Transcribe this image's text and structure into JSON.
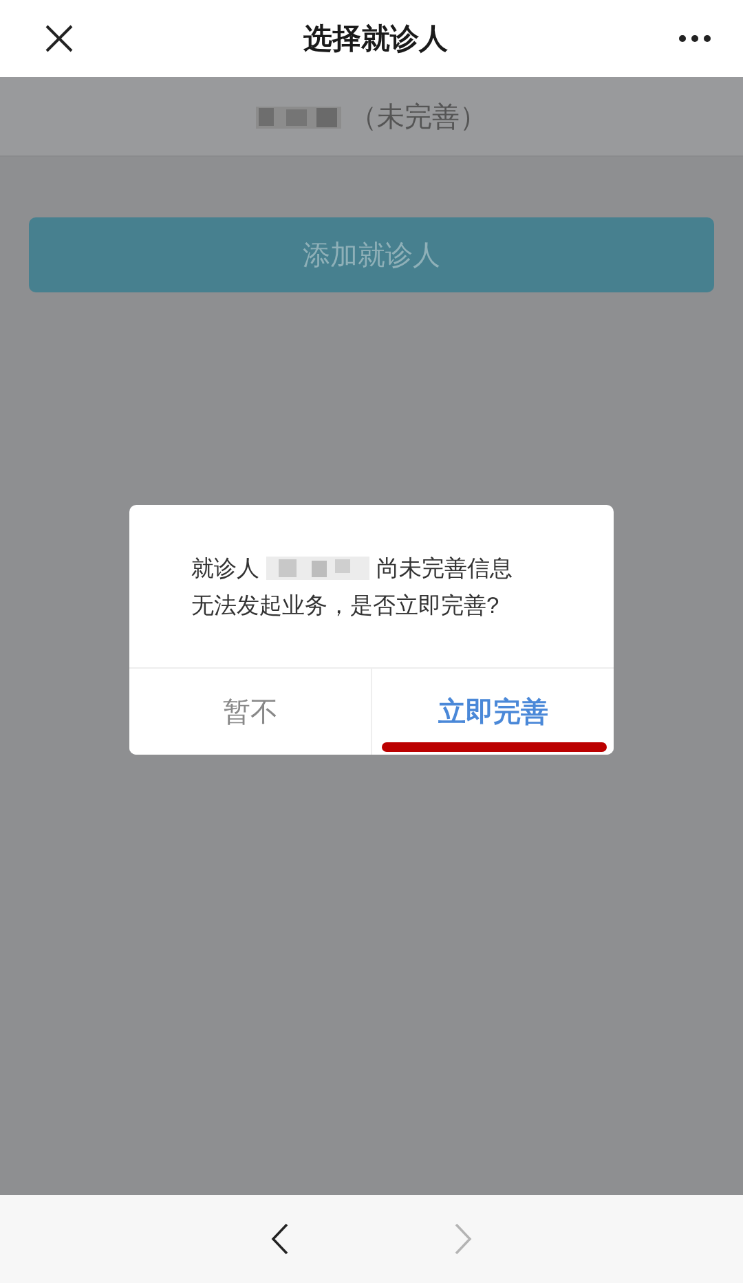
{
  "header": {
    "title": "选择就诊人"
  },
  "patient": {
    "status": "（未完善）"
  },
  "add_button": {
    "label": "添加就诊人"
  },
  "dialog": {
    "line1_before": "就诊人",
    "line1_after": "尚未完善信息",
    "line2": "无法发起业务，是否立即完善?",
    "buttons": [
      {
        "label": "暂不",
        "kind": "cancel",
        "highlighted": false
      },
      {
        "label": "立即完善",
        "kind": "confirm",
        "highlighted": true
      }
    ]
  },
  "nav": [
    {
      "kind": "back",
      "disabled": false
    },
    {
      "kind": "forward",
      "disabled": true
    }
  ]
}
